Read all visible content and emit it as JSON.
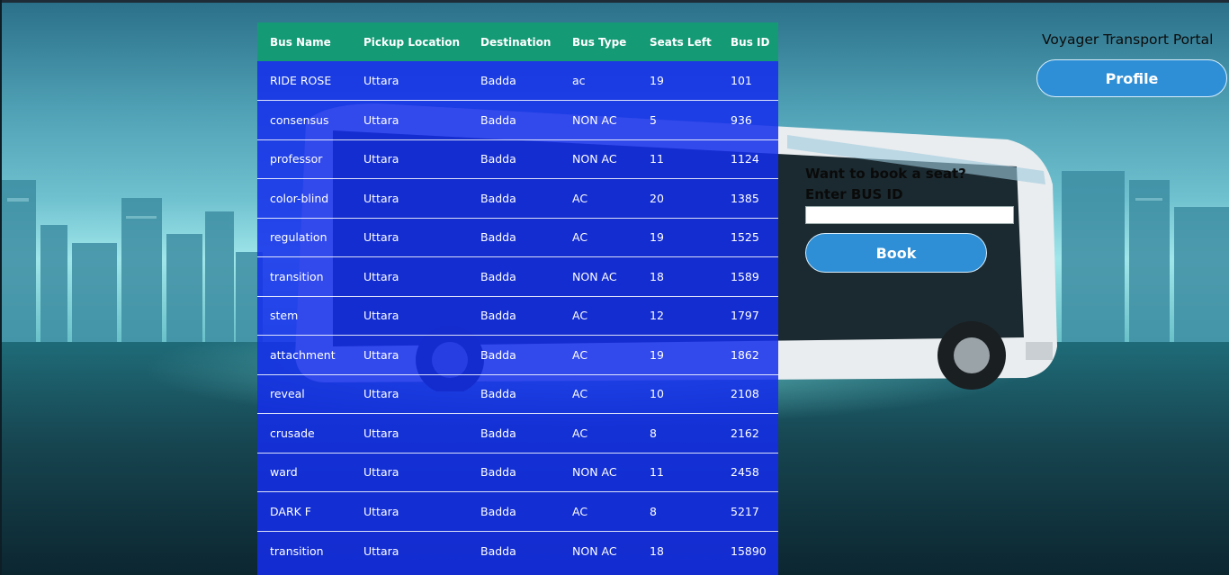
{
  "brand": {
    "title": "Voyager Transport Portal"
  },
  "nav": {
    "profile_label": "Profile"
  },
  "booking": {
    "question": "Want to book a seat?",
    "id_label": "Enter BUS ID",
    "input_value": "",
    "book_label": "Book"
  },
  "table": {
    "headers": [
      "Bus Name",
      "Pickup Location",
      "Destination",
      "Bus Type",
      "Seats Left",
      "Bus ID"
    ],
    "rows": [
      [
        "RIDE ROSE",
        "Uttara",
        "Badda",
        "ac",
        "19",
        "101"
      ],
      [
        "consensus",
        "Uttara",
        "Badda",
        "NON AC",
        "5",
        "936"
      ],
      [
        "professor",
        "Uttara",
        "Badda",
        "NON AC",
        "11",
        "1124"
      ],
      [
        "color-blind",
        "Uttara",
        "Badda",
        "AC",
        "20",
        "1385"
      ],
      [
        "regulation",
        "Uttara",
        "Badda",
        "AC",
        "19",
        "1525"
      ],
      [
        "transition",
        "Uttara",
        "Badda",
        "NON AC",
        "18",
        "1589"
      ],
      [
        "stem",
        "Uttara",
        "Badda",
        "AC",
        "12",
        "1797"
      ],
      [
        "attachment",
        "Uttara",
        "Badda",
        "AC",
        "19",
        "1862"
      ],
      [
        "reveal",
        "Uttara",
        "Badda",
        "AC",
        "10",
        "2108"
      ],
      [
        "crusade",
        "Uttara",
        "Badda",
        "AC",
        "8",
        "2162"
      ],
      [
        "ward",
        "Uttara",
        "Badda",
        "NON AC",
        "11",
        "2458"
      ],
      [
        "DARK F",
        "Uttara",
        "Badda",
        "AC",
        "8",
        "5217"
      ],
      [
        "transition",
        "Uttara",
        "Badda",
        "NON AC",
        "18",
        "15890"
      ]
    ]
  },
  "colors": {
    "table_header": "#159a76",
    "table_body": "#142deb",
    "button": "#2e8fd6"
  }
}
